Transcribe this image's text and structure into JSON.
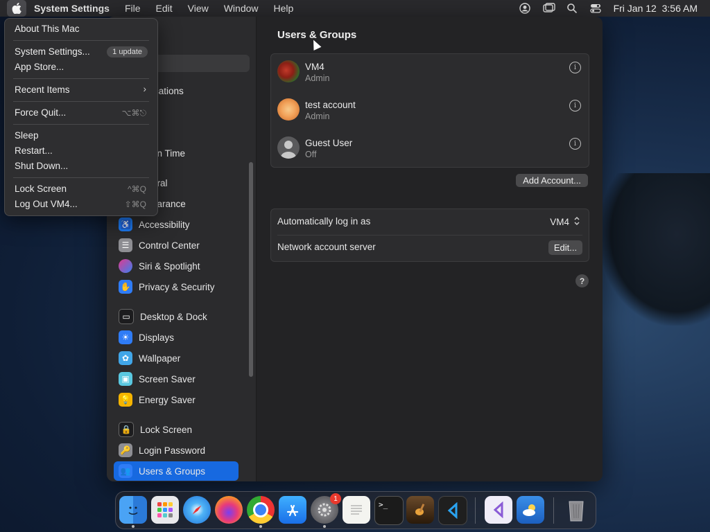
{
  "menubar": {
    "app": "System Settings",
    "menus": [
      "File",
      "Edit",
      "View",
      "Window",
      "Help"
    ],
    "datetime": "Fri Jan 12  3:56 AM",
    "icons": [
      "user-icon",
      "screen-mirror-icon",
      "search-icon",
      "control-center-icon"
    ]
  },
  "apple_menu": {
    "about": "About This Mac",
    "system_settings": "System Settings...",
    "update_badge": "1 update",
    "app_store": "App Store...",
    "recent_items": "Recent Items",
    "force_quit": "Force Quit...",
    "force_quit_shortcut": "⌥⌘⎋",
    "sleep": "Sleep",
    "restart": "Restart...",
    "shut_down": "Shut Down...",
    "lock_screen": "Lock Screen",
    "lock_shortcut": "^⌘Q",
    "log_out": "Log Out VM4...",
    "log_out_shortcut": "⇧⌘Q"
  },
  "sidebar": {
    "search_placeholder": "h",
    "partial_items": [
      "ications",
      "d",
      "s",
      "en Time",
      "eral",
      "earance"
    ],
    "items": [
      {
        "label": "Accessibility",
        "color": "#1d7af3"
      },
      {
        "label": "Control Center",
        "color": "#8e8e93"
      },
      {
        "label": "Siri & Spotlight",
        "color": "#b44fd0"
      },
      {
        "label": "Privacy & Security",
        "color": "#2f7cf6"
      },
      {
        "label": "Desktop & Dock",
        "color": "#1c1c1e"
      },
      {
        "label": "Displays",
        "color": "#2f7cf6"
      },
      {
        "label": "Wallpaper",
        "color": "#41a6e8"
      },
      {
        "label": "Screen Saver",
        "color": "#5ac8e0"
      },
      {
        "label": "Energy Saver",
        "color": "#f5b400"
      },
      {
        "label": "Lock Screen",
        "color": "#1c1c1e"
      },
      {
        "label": "Login Password",
        "color": "#8e8e93"
      },
      {
        "label": "Users & Groups",
        "color": "#2f7cf6"
      }
    ]
  },
  "content": {
    "title": "Users & Groups",
    "users": [
      {
        "name": "VM4",
        "role": "Admin"
      },
      {
        "name": "test account",
        "role": "Admin"
      },
      {
        "name": "Guest User",
        "role": "Off"
      }
    ],
    "add_account": "Add Account...",
    "auto_login_label": "Automatically log in as",
    "auto_login_value": "VM4",
    "network_label": "Network account server",
    "edit_button": "Edit...",
    "help": "?"
  },
  "dock": {
    "apps": [
      "Finder",
      "Launchpad",
      "Safari",
      "Firefox",
      "Chrome",
      "App Store",
      "System Settings",
      "TextEdit",
      "Terminal",
      "GarageBand",
      "VS Code",
      "Visual Studio",
      "Weather",
      "Trash"
    ],
    "settings_badge": "1"
  }
}
